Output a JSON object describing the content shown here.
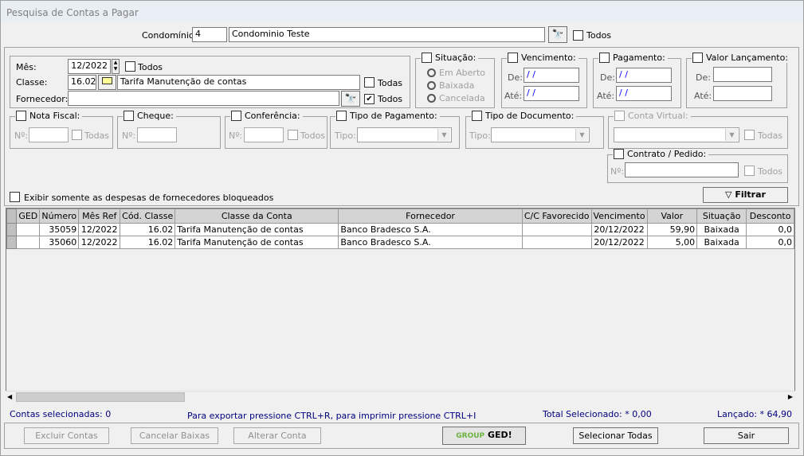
{
  "window": {
    "title": "Pesquisa de Contas a Pagar"
  },
  "condominio": {
    "label": "Condomínio:",
    "code": "4",
    "name": "Condominio Teste",
    "todos_label": "Todos",
    "todos_checked": false
  },
  "mes": {
    "label": "Mês:",
    "value": "12/2022",
    "todos_label": "Todos",
    "todos_checked": false
  },
  "classe": {
    "label": "Classe:",
    "code": "16.02",
    "name": "Tarifa Manutenção de contas",
    "todas_label": "Todas",
    "todas_checked": false
  },
  "fornecedor": {
    "label": "Fornecedor:",
    "value": "",
    "todos_label": "Todos",
    "todos_checked": true
  },
  "situacao": {
    "label": "Situação:",
    "options": [
      "Em Aberto",
      "Baixada",
      "Cancelada"
    ]
  },
  "vencimento": {
    "label": "Vencimento:",
    "de_label": "De:",
    "ate_label": "Até:",
    "de": " / /",
    "ate": " / /"
  },
  "pagamento": {
    "label": "Pagamento:",
    "de_label": "De:",
    "ate_label": "Até:",
    "de": " / /",
    "ate": " / /"
  },
  "valor_lancamento": {
    "label": "Valor Lançamento:",
    "de_label": "De:",
    "ate_label": "Até:",
    "de": "",
    "ate": ""
  },
  "nota_fiscal": {
    "label": "Nota Fiscal:",
    "num_label": "Nº:",
    "todas_label": "Todas"
  },
  "cheque": {
    "label": "Cheque:",
    "num_label": "Nº:"
  },
  "conferencia": {
    "label": "Conferência:",
    "num_label": "Nº:",
    "todos_label": "Todos"
  },
  "tipo_pagamento": {
    "label": "Tipo de Pagamento:",
    "tipo_label": "Tipo:"
  },
  "tipo_documento": {
    "label": "Tipo de Documento:",
    "tipo_label": "Tipo:"
  },
  "conta_virtual": {
    "label": "Conta Virtual:",
    "todas_label": "Todas"
  },
  "contrato": {
    "label": "Contrato / Pedido:",
    "num_label": "Nº:",
    "todos_label": "Todos"
  },
  "bloqueados_label": "Exibir somente as despesas de fornecedores bloqueados",
  "filtrar_label": "Filtrar",
  "grid": {
    "columns": [
      "GED",
      "Número",
      "Mês Ref",
      "Cód. Classe",
      "Classe da Conta",
      "Fornecedor",
      "C/C Favorecido",
      "Vencimento",
      "Valor",
      "Situação",
      "Desconto"
    ],
    "rows": [
      [
        "",
        "35059",
        "12/2022",
        "16.02",
        "Tarifa Manutenção de contas",
        "Banco Bradesco S.A.",
        "",
        "20/12/2022",
        "59,90",
        "Baixada",
        "0,0"
      ],
      [
        "",
        "35060",
        "12/2022",
        "16.02",
        "Tarifa Manutenção de contas",
        "Banco Bradesco S.A.",
        "",
        "20/12/2022",
        "5,00",
        "Baixada",
        "0,0"
      ]
    ]
  },
  "status": {
    "selecionadas": "Contas selecionadas: 0",
    "hint": "Para exportar pressione CTRL+R,  para imprimir pressione CTRL+I",
    "total": "Total Selecionado: * 0,00",
    "lancado": "Lançado: * 64,90"
  },
  "buttons": {
    "excluir": "Excluir Contas",
    "cancelar": "Cancelar Baixas",
    "alterar": "Alterar Conta",
    "ged_group": "GROUP",
    "ged": "GED!",
    "selecionar": "Selecionar Todas",
    "sair": "Sair"
  },
  "colors": {
    "status_text": "#00007f",
    "ged_green": "#6cb33f"
  }
}
